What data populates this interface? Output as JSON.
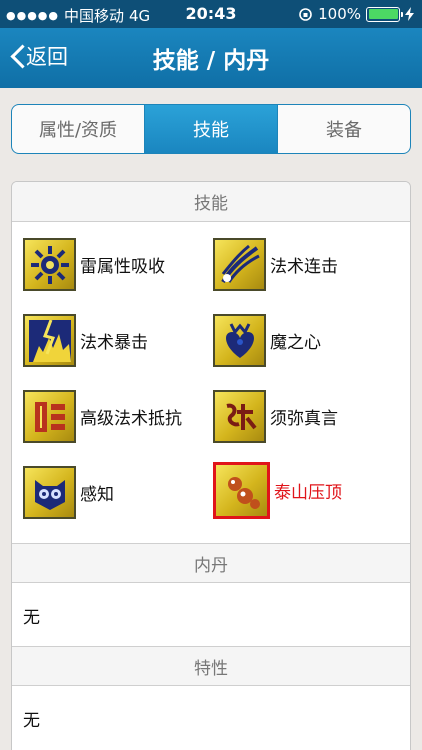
{
  "status_bar": {
    "carrier": "中国移动",
    "network": "4G",
    "time": "20:43",
    "battery": "100%",
    "battery_level": 1.0
  },
  "nav": {
    "back_label": "返回",
    "title": "技能 / 内丹"
  },
  "tabs": [
    {
      "label": "属性/资质",
      "active": false
    },
    {
      "label": "技能",
      "active": true
    },
    {
      "label": "装备",
      "active": false
    }
  ],
  "sections": {
    "skills_header": "技能",
    "neidan_header": "内丹",
    "neidan_value": "无",
    "traits_header": "特性",
    "traits_value": "无"
  },
  "skills": [
    {
      "label": "雷属性吸收",
      "icon": "thunder-absorb-icon",
      "selected": false
    },
    {
      "label": "法术连击",
      "icon": "spell-combo-icon",
      "selected": false
    },
    {
      "label": "法术暴击",
      "icon": "spell-crit-icon",
      "selected": false
    },
    {
      "label": "魔之心",
      "icon": "demon-heart-icon",
      "selected": false
    },
    {
      "label": "高级法术抵抗",
      "icon": "spell-resist-icon",
      "selected": false
    },
    {
      "label": "须弥真言",
      "icon": "mantra-icon",
      "selected": false
    },
    {
      "label": "感知",
      "icon": "perception-icon",
      "selected": false
    },
    {
      "label": "泰山压顶",
      "icon": "mountain-crush-icon",
      "selected": true
    }
  ],
  "colors": {
    "nav_blue": "#1580b8",
    "accent": "#1d84b9",
    "selected_red": "#e0141a",
    "icon_gold": "#e8cf32",
    "battery_green": "#4cd964"
  }
}
